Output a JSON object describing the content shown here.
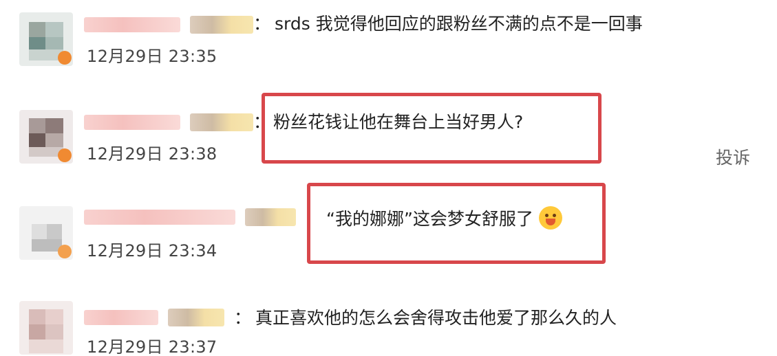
{
  "comments": [
    {
      "separator": "：",
      "text": "srds 我觉得他回应的跟粉丝不满的点不是一回事",
      "time": "12月29日 23:35"
    },
    {
      "separator": "：",
      "text": "粉丝花钱让他在舞台上当好男人?",
      "time": "12月29日 23:38"
    },
    {
      "separator": "",
      "text": "“我的娜娜”这会梦女舒服了",
      "time": "12月29日 23:34",
      "emoji": "tongue-out-emoji"
    },
    {
      "separator": "：",
      "text": "真正喜欢他的怎么会舍得攻击他爱了那么久的人",
      "time": "12月29日 23:37"
    }
  ],
  "actions": {
    "report_label": "投诉"
  },
  "colors": {
    "highlight_border": "#d8474b",
    "timestamp": "#444444",
    "report_text": "#666666"
  }
}
